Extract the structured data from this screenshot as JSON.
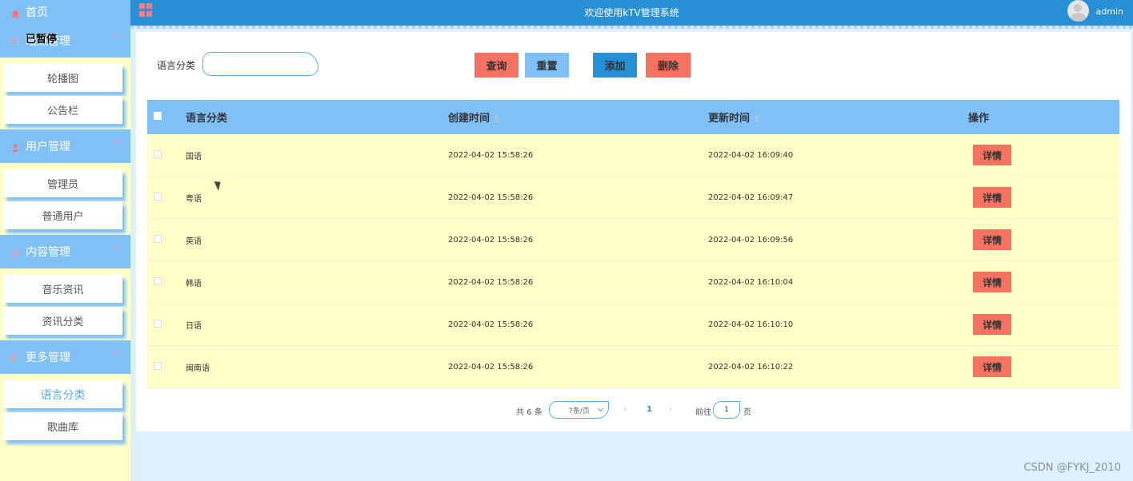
{
  "sidebar": {
    "home_label": "首页",
    "paused_label": "已暂停",
    "groups": [
      {
        "label": "站点管理",
        "items": [
          "轮播图",
          "公告栏"
        ]
      },
      {
        "label": "用户管理",
        "items": [
          "管理员",
          "普通用户"
        ]
      },
      {
        "label": "内容管理",
        "items": [
          "音乐资讯",
          "资讯分类"
        ]
      },
      {
        "label": "更多管理",
        "items": [
          "语言分类",
          "歌曲库"
        ]
      }
    ],
    "active_item": "语言分类"
  },
  "header": {
    "title": "欢迎使用kTV管理系统",
    "user": "admin"
  },
  "filter": {
    "label": "语言分类",
    "value": "",
    "placeholder": ""
  },
  "toolbar": {
    "search_label": "查询",
    "reset_label": "重置",
    "add_label": "添加",
    "delete_label": "删除"
  },
  "table": {
    "columns": [
      "语言分类",
      "创建时间",
      "更新时间",
      "操作"
    ],
    "rows": [
      {
        "name": "国语",
        "created": "2022-04-02 15:58:26",
        "updated": "2022-04-02 16:09:40",
        "action": "详情"
      },
      {
        "name": "粤语",
        "created": "2022-04-02 15:58:26",
        "updated": "2022-04-02 16:09:47",
        "action": "详情"
      },
      {
        "name": "英语",
        "created": "2022-04-02 15:58:26",
        "updated": "2022-04-02 16:09:56",
        "action": "详情"
      },
      {
        "name": "韩语",
        "created": "2022-04-02 15:58:26",
        "updated": "2022-04-02 16:10:04",
        "action": "详情"
      },
      {
        "name": "日语",
        "created": "2022-04-02 15:58:26",
        "updated": "2022-04-02 16:10:10",
        "action": "详情"
      },
      {
        "name": "闽南语",
        "created": "2022-04-02 15:58:26",
        "updated": "2022-04-02 16:10:22",
        "action": "详情"
      }
    ]
  },
  "pagination": {
    "total_label": "共 6 条",
    "page_size": "7条/页",
    "prev": "‹",
    "current_page": "1",
    "next": "›",
    "goto_label": "前往",
    "goto_value": "1",
    "goto_unit": "页"
  },
  "watermark": "CSDN @FYKJ_2010",
  "colors": {
    "header_bg": "#2590d6",
    "sidebar_head": "#7fc0f7",
    "sidebar_bg": "#fffec6",
    "danger": "#f57261",
    "row_bg": "#fffec6"
  },
  "icons": {
    "home": "home-icon",
    "site": "monitor-icon",
    "user": "user-icon",
    "content": "target-icon",
    "more": "copy-icon",
    "menu": "grid-icon",
    "avatar": "avatar-icon"
  }
}
